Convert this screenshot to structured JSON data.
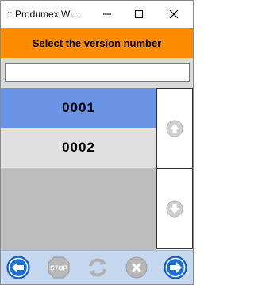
{
  "window": {
    "title": ":: Produmex Wi...",
    "controls": [
      "minimize-icon",
      "maximize-icon",
      "close-icon"
    ]
  },
  "header": {
    "title": "Select the version number"
  },
  "search": {
    "value": "",
    "placeholder": ""
  },
  "list": {
    "items": [
      {
        "label": "0001",
        "selected": true
      },
      {
        "label": "0002",
        "selected": false
      }
    ]
  },
  "scroll": {
    "up_icon": "arrow-up-circle-icon",
    "down_icon": "arrow-down-circle-icon"
  },
  "toolbar": {
    "stop_label": "STOP",
    "buttons": [
      "back-arrow-icon",
      "stop-icon",
      "refresh-icon",
      "cancel-icon",
      "next-arrow-icon"
    ]
  },
  "colors": {
    "header_bg": "#ff8c00",
    "selected_row": "#6b93e6",
    "normal_row": "#e0e0e0",
    "toolbar_bg": "#c6d7f0",
    "nav_blue": "#1a6fd6"
  }
}
